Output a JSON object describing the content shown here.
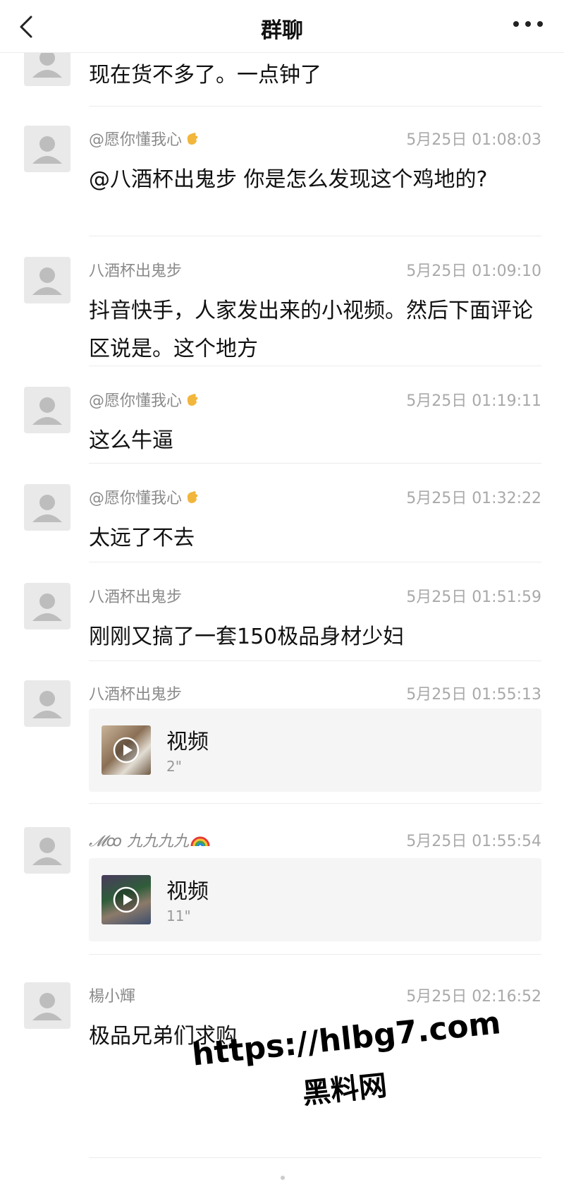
{
  "header": {
    "title": "群聊"
  },
  "messages": [
    {
      "name": "",
      "time": "",
      "text": "现在货不多了。一点钟了"
    },
    {
      "name": "@愿你懂我心",
      "emoji": "clapping-hand-icon",
      "time": "5月25日 01:08:03",
      "text": "@八酒杯出鬼步 你是怎么发现这个鸡地的?"
    },
    {
      "name": "八酒杯出鬼步",
      "time": "5月25日 01:09:10",
      "text": "抖音快手，人家发出来的小视频。然后下面评论区说是。这个地方"
    },
    {
      "name": "@愿你懂我心",
      "emoji": "clapping-hand-icon",
      "time": "5月25日 01:19:11",
      "text": "这么牛逼"
    },
    {
      "name": "@愿你懂我心",
      "emoji": "clapping-hand-icon",
      "time": "5月25日 01:32:22",
      "text": "太远了不去"
    },
    {
      "name": "八酒杯出鬼步",
      "time": "5月25日 01:51:59",
      "text": "刚刚又搞了一套150极品身材少妇"
    },
    {
      "name": "八酒杯出鬼步",
      "time": "5月25日 01:55:13",
      "video": {
        "label": "视频",
        "duration": "2\""
      }
    },
    {
      "name": "𝓜ꝏ 九九九九",
      "emoji": "rainbow-icon",
      "time": "5月25日 01:55:54",
      "video": {
        "label": "视频",
        "duration": "11\""
      }
    },
    {
      "name": "楊小輝",
      "time": "5月25日 02:16:52",
      "text": "极品兄弟们求购"
    }
  ],
  "watermark": {
    "url": "https://hlbg7.com",
    "sub": "黑料网"
  },
  "colors": {
    "background": "#ffffff",
    "name_gray": "#8a8a8a",
    "time_gray": "#a9a9a9",
    "card_bg": "#f5f5f5",
    "separator": "#ececec"
  }
}
